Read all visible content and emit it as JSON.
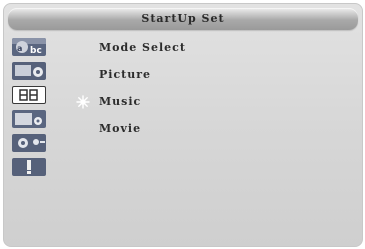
{
  "header": {
    "title": "StartUp Set"
  },
  "sidebar": {
    "items": [
      {
        "icon": "abc-icon"
      },
      {
        "icon": "picture-settings-icon"
      },
      {
        "icon": "channel-number-icon"
      },
      {
        "icon": "tv-settings-icon"
      },
      {
        "icon": "tools-icon"
      },
      {
        "icon": "alert-icon"
      }
    ]
  },
  "menu": {
    "items": [
      {
        "label": "Mode Select"
      },
      {
        "label": "Picture"
      },
      {
        "label": "Music",
        "selected": true
      },
      {
        "label": "Movie"
      }
    ]
  },
  "colors": {
    "frame": "#d7d7d7",
    "title_bar": "#a9a9a9",
    "text": "#2c2c2c",
    "icon_bg": "#4a5670"
  }
}
